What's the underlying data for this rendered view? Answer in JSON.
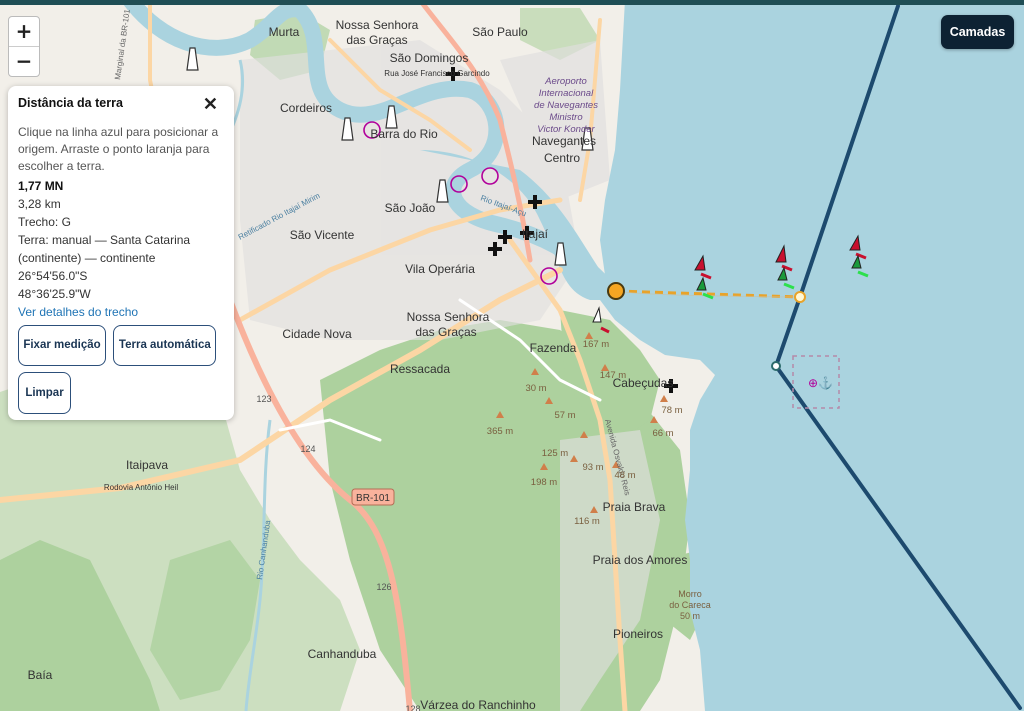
{
  "ui": {
    "zoom_in": "+",
    "zoom_out": "−",
    "layers_label": "Camadas"
  },
  "panel": {
    "title": "Distância da terra",
    "close_icon": "close-icon",
    "help_text": "Clique na linha azul para posicionar a origem. Arraste o ponto laranja para escolher a terra.",
    "distance_nm": "1,77 MN",
    "distance_km": "3,28 km",
    "stretch": "Trecho: G",
    "land_line1": "Terra: manual — Santa Catarina",
    "land_line2": "(continente) — continente",
    "lat": "26°54'56.0\"S",
    "lon": "48°36'25.9\"W",
    "details_link": "Ver detalhes do trecho",
    "btn_fix": "Fixar medição",
    "btn_auto": "Terra automática",
    "btn_clear": "Limpar"
  },
  "places": {
    "murta": "Murta",
    "nossa_graças_n1": "Nossa Senhora",
    "nossa_graças_n2": "das Graças",
    "sao_paulo": "São Paulo",
    "sao_domingos": "São Domingos",
    "rua_jf": "Rua José Francisco Garcindo",
    "aeroporto1": "Aeroporto",
    "aeroporto2": "Internacional",
    "aeroporto3": "de Navegantes",
    "aeroporto4": "Ministro",
    "aeroporto5": "Victor Konder",
    "cordeiros": "Cordeiros",
    "barra_do_rio": "Barra do Rio",
    "navegantes": "Navegantes",
    "centro": "Centro",
    "sao_joao": "São João",
    "sao_vicente": "São Vicente",
    "itajai": "Itajaí",
    "vila_operaria": "Vila Operária",
    "nossa_graças_s1": "Nossa Senhora",
    "nossa_graças_s2": "das Graças",
    "cidade_nova": "Cidade Nova",
    "ressacada": "Ressacada",
    "fazenda": "Fazenda",
    "cabecudas": "Cabeçudas",
    "itaipava": "Itaipava",
    "rodovia_ah": "Rodovia Antônio Heil",
    "br101": "BR-101",
    "praia_brava": "Praia Brava",
    "praia_amores": "Praia dos Amores",
    "morro1": "Morro",
    "morro2": "do Careca",
    "morro3": "50 m",
    "pioneiros": "Pioneiros",
    "canhanduba": "Canhanduba",
    "baia": "Baía",
    "varzea": "Várzea do Ranchinho",
    "rio_itajai": "Rio Itajaí-Açu",
    "reticulado": "Retificado Rio Itajaí Mirim",
    "rio_canhanduba": "Rio Canhanduba",
    "marginal": "Marginal da BR-101",
    "av_osvaldo": "Avenida Osvaldo Reis",
    "route_123": "123",
    "route_124": "124",
    "route_126": "126",
    "route_128": "128"
  },
  "elevations": {
    "e167": "167 m",
    "e147": "147 m",
    "e30": "30 m",
    "e57": "57 m",
    "e78": "78 m",
    "e365": "365 m",
    "e66": "66 m",
    "e125": "125 m",
    "e93": "93 m",
    "e48": "48 m",
    "e198": "198 m",
    "e116": "116 m"
  },
  "colors": {
    "sea": "#aad3df",
    "land": "#f2efe9",
    "forest": "#add19e",
    "route_line": "#1d4a6e",
    "measure_line": "#e8a32a",
    "origin_point": "#fff7d6",
    "land_point": "#f5a623",
    "primary_road": "#fcd6a4",
    "trunk_road": "#f9b29c"
  }
}
